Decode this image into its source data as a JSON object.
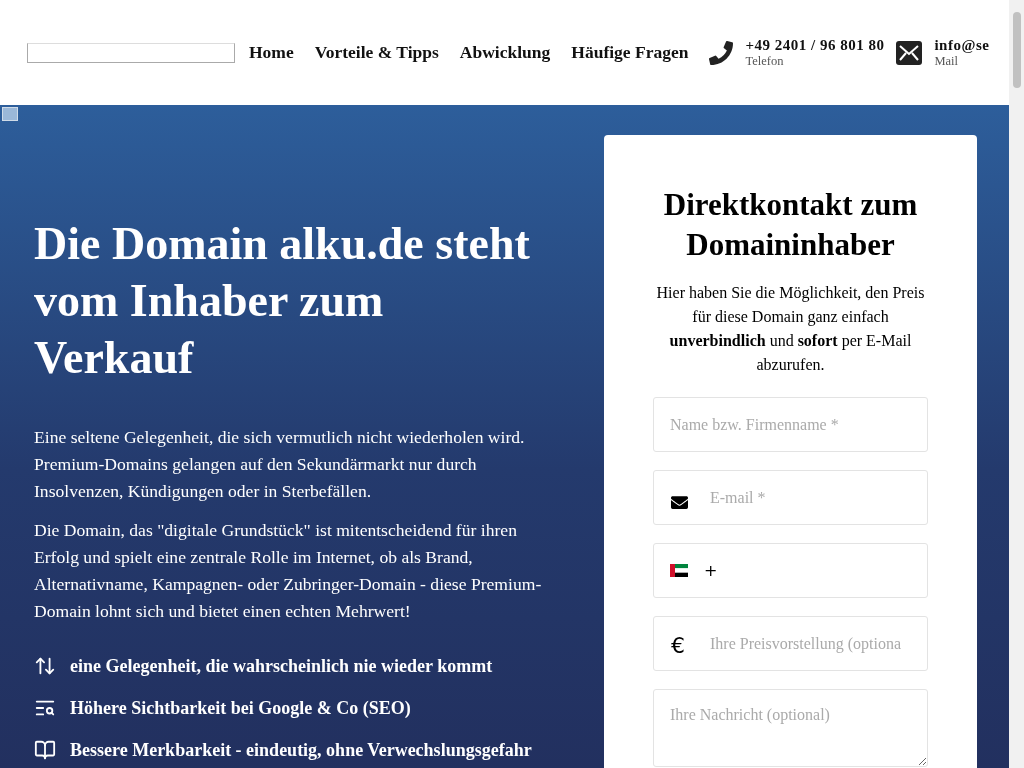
{
  "header": {
    "nav": [
      {
        "label": "Home"
      },
      {
        "label": "Vorteile & Tipps"
      },
      {
        "label": "Abwicklung"
      },
      {
        "label": "Häufige Fragen"
      }
    ],
    "contacts": [
      {
        "kind": "phone",
        "value": "+49 2401 / 96 801 80",
        "caption": "Telefon"
      },
      {
        "kind": "mail",
        "value": "info@se",
        "caption": "Mail"
      }
    ]
  },
  "hero": {
    "title": "Die Domain alku.de steht vom Inhaber zum Verkauf",
    "paragraphs": [
      "Eine seltene Gelegenheit, die sich vermutlich nicht wiederholen wird. Premium-Domains gelangen auf den Sekundärmarkt nur durch Insolvenzen, Kündigungen oder in Sterbefällen.",
      "Die Domain, das \"digitale Grundstück\" ist mitentscheidend für ihren Erfolg und spielt eine zentrale Rolle im Internet, ob als Brand, Alternativname, Kampagnen- oder Zubringer-Domain - diese Premium-Domain lohnt sich und bietet einen echten Mehrwert!"
    ],
    "benefits": [
      {
        "kind": "arrows",
        "text": "eine Gelegenheit, die wahrscheinlich nie wieder kommt"
      },
      {
        "kind": "search",
        "text": "Höhere Sichtbarkeit bei Google & Co (SEO)"
      },
      {
        "kind": "book",
        "text": "Bessere Merkbarkeit - eindeutig, ohne Verwechslungsgefahr"
      }
    ]
  },
  "form": {
    "title": "Direktkontakt zum Domaininhaber",
    "intro": "Hier haben Sie die Möglichkeit, den Preis für diese Domain ganz einfach **unverbindlich** und **sofort** per E-Mail abzurufen.",
    "fields": [
      {
        "kind": "text",
        "placeholder": "Name bzw. Firmenname *"
      },
      {
        "kind": "email",
        "placeholder": "E-mail *"
      },
      {
        "kind": "phone",
        "value": "+"
      },
      {
        "kind": "price",
        "prefix": "€",
        "placeholder": "Ihre Preisvorstellung (optiona"
      },
      {
        "kind": "message",
        "placeholder": "Ihre Nachricht (optional)"
      }
    ]
  }
}
